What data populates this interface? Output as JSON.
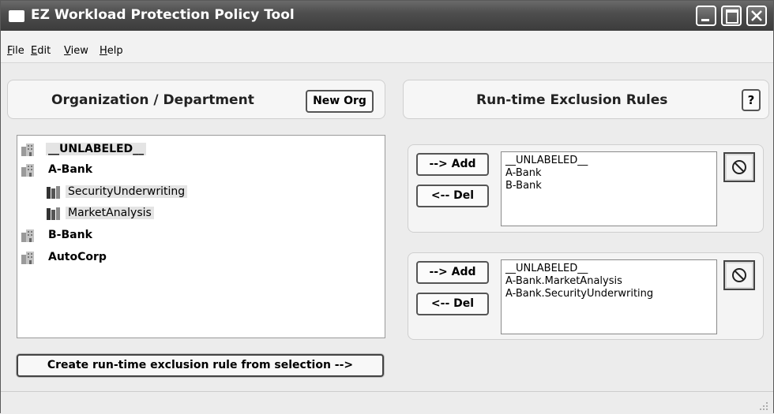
{
  "window": {
    "title": "EZ Workload Protection Policy Tool"
  },
  "menu": [
    {
      "mnemonic": "F",
      "rest": "ile"
    },
    {
      "mnemonic": "E",
      "rest": "dit"
    },
    {
      "mnemonic": "V",
      "rest": "iew"
    },
    {
      "mnemonic": "H",
      "rest": "elp"
    }
  ],
  "left_panel": {
    "title": "Organization / Department",
    "new_org_label": "New Org",
    "tree": [
      {
        "label": "__UNLABELED__",
        "kind": "org",
        "selected": true
      },
      {
        "label": "A-Bank",
        "kind": "org",
        "selected": false
      },
      {
        "label": "SecurityUnderwriting",
        "kind": "dept",
        "selected": true
      },
      {
        "label": "MarketAnalysis",
        "kind": "dept",
        "selected": true
      },
      {
        "label": "B-Bank",
        "kind": "org",
        "selected": false
      },
      {
        "label": "AutoCorp",
        "kind": "org",
        "selected": false
      }
    ],
    "create_label": "Create run-time exclusion rule from selection -->"
  },
  "right_panel": {
    "title": "Run-time Exclusion Rules",
    "help_label": "?",
    "rules": [
      {
        "add_label": "--> Add",
        "del_label": "<-- Del",
        "entries": [
          "__UNLABELED__",
          "A-Bank",
          "B-Bank"
        ],
        "block_icon": "prohibited-icon"
      },
      {
        "add_label": "--> Add",
        "del_label": "<-- Del",
        "entries": [
          "__UNLABELED__",
          "A-Bank.MarketAnalysis",
          "A-Bank.SecurityUnderwriting"
        ],
        "block_icon": "prohibited-icon"
      }
    ]
  }
}
